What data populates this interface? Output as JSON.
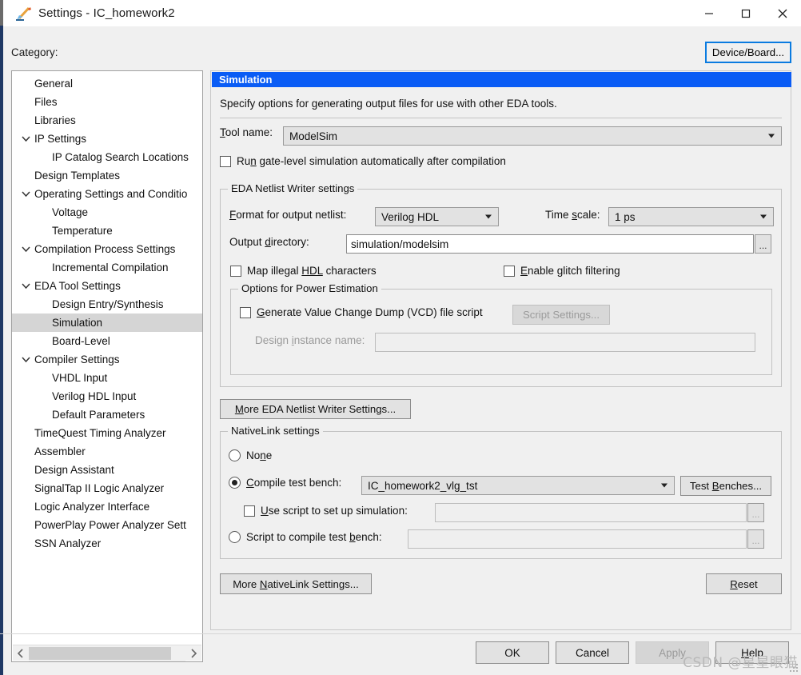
{
  "window": {
    "title": "Settings - IC_homework2",
    "icon": "pencil-icon",
    "minimize": "minimize-icon",
    "maximize": "maximize-icon",
    "close": "close-icon"
  },
  "top": {
    "category_label": "Category:",
    "device_board_button": "Device/Board..."
  },
  "tree": {
    "items": [
      {
        "label": "General",
        "level": 1,
        "expandable": false,
        "selected": false
      },
      {
        "label": "Files",
        "level": 1,
        "expandable": false,
        "selected": false
      },
      {
        "label": "Libraries",
        "level": 1,
        "expandable": false,
        "selected": false
      },
      {
        "label": "IP Settings",
        "level": 1,
        "expandable": true,
        "selected": false
      },
      {
        "label": "IP Catalog Search Locations",
        "level": 2,
        "expandable": false,
        "selected": false
      },
      {
        "label": "Design Templates",
        "level": 1,
        "expandable": false,
        "selected": false
      },
      {
        "label": "Operating Settings and Conditio",
        "level": 1,
        "expandable": true,
        "selected": false
      },
      {
        "label": "Voltage",
        "level": 2,
        "expandable": false,
        "selected": false
      },
      {
        "label": "Temperature",
        "level": 2,
        "expandable": false,
        "selected": false
      },
      {
        "label": "Compilation Process Settings",
        "level": 1,
        "expandable": true,
        "selected": false
      },
      {
        "label": "Incremental Compilation",
        "level": 2,
        "expandable": false,
        "selected": false
      },
      {
        "label": "EDA Tool Settings",
        "level": 1,
        "expandable": true,
        "selected": false
      },
      {
        "label": "Design Entry/Synthesis",
        "level": 2,
        "expandable": false,
        "selected": false
      },
      {
        "label": "Simulation",
        "level": 2,
        "expandable": false,
        "selected": true
      },
      {
        "label": "Board-Level",
        "level": 2,
        "expandable": false,
        "selected": false
      },
      {
        "label": "Compiler Settings",
        "level": 1,
        "expandable": true,
        "selected": false
      },
      {
        "label": "VHDL Input",
        "level": 2,
        "expandable": false,
        "selected": false
      },
      {
        "label": "Verilog HDL Input",
        "level": 2,
        "expandable": false,
        "selected": false
      },
      {
        "label": "Default Parameters",
        "level": 2,
        "expandable": false,
        "selected": false
      },
      {
        "label": "TimeQuest Timing Analyzer",
        "level": 1,
        "expandable": false,
        "selected": false
      },
      {
        "label": "Assembler",
        "level": 1,
        "expandable": false,
        "selected": false
      },
      {
        "label": "Design Assistant",
        "level": 1,
        "expandable": false,
        "selected": false
      },
      {
        "label": "SignalTap II Logic Analyzer",
        "level": 1,
        "expandable": false,
        "selected": false
      },
      {
        "label": "Logic Analyzer Interface",
        "level": 1,
        "expandable": false,
        "selected": false
      },
      {
        "label": "PowerPlay Power Analyzer Sett",
        "level": 1,
        "expandable": false,
        "selected": false
      },
      {
        "label": "SSN Analyzer",
        "level": 1,
        "expandable": false,
        "selected": false
      }
    ]
  },
  "panel": {
    "header": "Simulation",
    "description": "Specify options for generating output files for use with other EDA tools.",
    "tool_name_label_pre": "",
    "tool_name_label_mnemonic": "T",
    "tool_name_label_post": "ool name:",
    "tool_name_value": "ModelSim",
    "run_gate_level_pre": "Ru",
    "run_gate_level_mnemonic": "n",
    "run_gate_level_post": " gate-level simulation automatically after compilation",
    "run_gate_level_checked": false
  },
  "netlist": {
    "group_title": "EDA Netlist Writer settings",
    "format_label_mnemonic": "F",
    "format_label_post": "ormat for output netlist:",
    "format_value": "Verilog HDL",
    "timescale_label_pre": "Time ",
    "timescale_label_mnemonic": "s",
    "timescale_label_post": "cale:",
    "timescale_value": "1 ps",
    "outdir_label_pre": "Output ",
    "outdir_label_mnemonic": "d",
    "outdir_label_post": "irectory:",
    "outdir_value": "simulation/modelsim",
    "browse_label": "...",
    "map_illegal_pre": "Map illegal ",
    "map_illegal_mnemonic": "HDL",
    "map_illegal_post": " characters",
    "map_illegal_checked": false,
    "glitch_mnemonic": "E",
    "glitch_post": "nable glitch filtering",
    "glitch_checked": false,
    "power_group_title": "Options for Power Estimation",
    "vcd_mnemonic": "G",
    "vcd_post": "enerate Value Change Dump (VCD) file script",
    "vcd_checked": false,
    "script_settings_button": "Script Settings...",
    "script_settings_disabled": true,
    "design_instance_label_pre": "Design ",
    "design_instance_label_mnemonic": "i",
    "design_instance_label_post": "nstance name:",
    "design_instance_value": "",
    "design_instance_disabled": true,
    "more_button_mnemonic": "M",
    "more_button_post": "ore EDA Netlist Writer Settings..."
  },
  "nativelink": {
    "group_title": "NativeLink settings",
    "none_pre": "No",
    "none_mnemonic": "n",
    "none_post": "e",
    "none_selected": false,
    "compile_tb_mnemonic": "C",
    "compile_tb_post": "ompile test bench:",
    "compile_tb_selected": true,
    "compile_tb_value": "IC_homework2_vlg_tst",
    "test_benches_pre": "Test ",
    "test_benches_mnemonic": "B",
    "test_benches_post": "enches...",
    "use_script_mnemonic": "U",
    "use_script_post": "se script to set up simulation:",
    "use_script_checked": false,
    "use_script_value": "",
    "script_compile_pre": "Script to compile test ",
    "script_compile_mnemonic": "b",
    "script_compile_post": "ench:",
    "script_compile_selected": false,
    "script_compile_value": "",
    "browse_label": "...",
    "more_button_pre": "More ",
    "more_button_mnemonic": "N",
    "more_button_post": "ativeLink Settings...",
    "reset_mnemonic": "R",
    "reset_post": "eset"
  },
  "dialog_buttons": {
    "ok": "OK",
    "cancel": "Cancel",
    "apply": "Apply",
    "apply_disabled": true,
    "help_mnemonic": "H",
    "help_post": "elp"
  },
  "watermark": "CSDN @星星眼猫",
  "colors": {
    "header_blue": "#0a5cf5",
    "focus_blue": "#0a7be0",
    "selection_gray": "#d5d5d5",
    "panel_bg": "#f0f0f0"
  }
}
